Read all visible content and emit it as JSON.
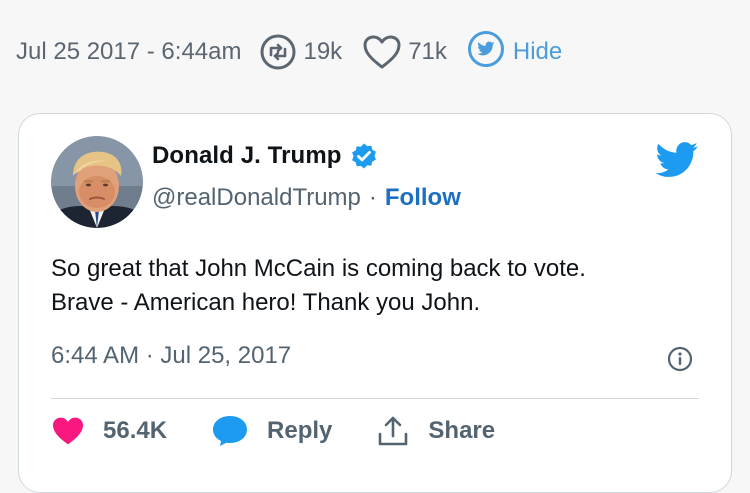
{
  "meta": {
    "date": "Jul 25 2017 - 6:44am",
    "retweets": "19k",
    "likes": "71k",
    "hide_label": "Hide"
  },
  "tweet": {
    "author_name": "Donald J. Trump",
    "handle": "@realDonaldTrump",
    "separator": "·",
    "follow_label": "Follow",
    "text_line1": "So great that John McCain is coming back to vote.",
    "text_line2": "Brave - American hero! Thank you John.",
    "timestamp": "6:44 AM · Jul 25, 2017",
    "likes": "56.4K",
    "reply_label": "Reply",
    "share_label": "Share"
  },
  "colors": {
    "page_bg": "#f7f7f7",
    "card_bg": "#ffffff",
    "accent_blue": "#1d9bf0",
    "link_blue": "#1d6fc4",
    "like_pink": "#f91880",
    "muted_text": "#536471"
  },
  "icons": {
    "retweet": "retweet-icon",
    "like": "heart-icon",
    "hide": "twitter-bird-circle-icon",
    "verified": "verified-badge-icon",
    "brand": "twitter-bird-icon",
    "info": "info-icon",
    "reply": "reply-bubble-icon",
    "share": "share-icon"
  }
}
